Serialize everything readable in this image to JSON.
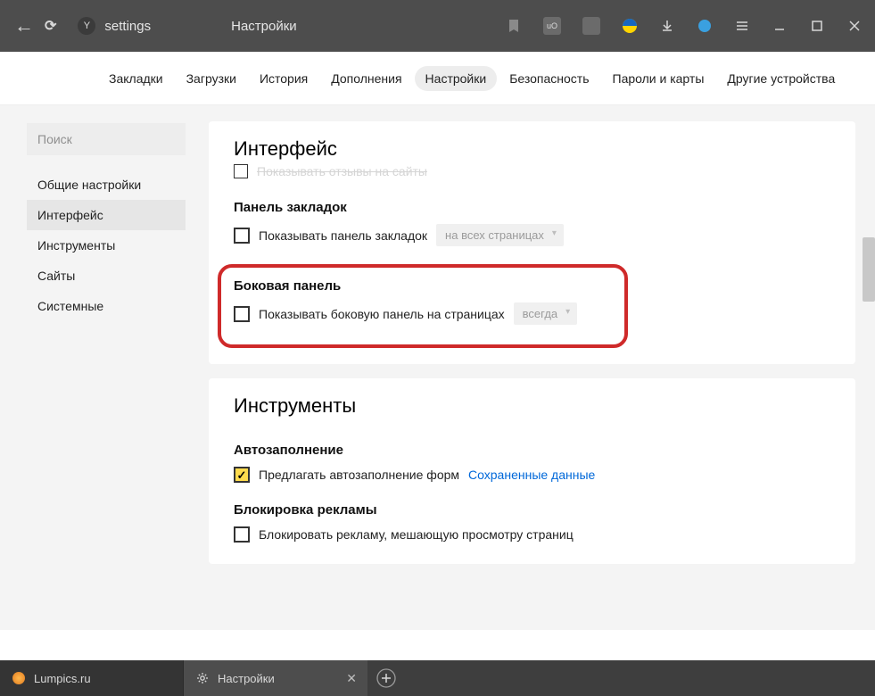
{
  "chrome": {
    "url": "settings",
    "title": "Настройки"
  },
  "topnav": {
    "items": [
      "Закладки",
      "Загрузки",
      "История",
      "Дополнения",
      "Настройки",
      "Безопасность",
      "Пароли и карты",
      "Другие устройства"
    ],
    "active_index": 4
  },
  "sidebar": {
    "search_placeholder": "Поиск",
    "items": [
      "Общие настройки",
      "Интерфейс",
      "Инструменты",
      "Сайты",
      "Системные"
    ],
    "active_index": 1
  },
  "card_interface": {
    "heading": "Интерфейс",
    "cutoff_fragment": "Показывать отзывы на сайты",
    "bookmarks": {
      "title": "Панель закладок",
      "checkbox_label": "Показывать панель закладок",
      "select_value": "на всех страницах"
    },
    "side_panel": {
      "title": "Боковая панель",
      "checkbox_label": "Показывать боковую панель на страницах",
      "select_value": "всегда"
    }
  },
  "card_tools": {
    "heading": "Инструменты",
    "autofill": {
      "title": "Автозаполнение",
      "checkbox_label": "Предлагать автозаполнение форм",
      "link_label": "Сохраненные данные"
    },
    "adblock": {
      "title": "Блокировка рекламы",
      "row1": "Блокировать рекламу, мешающую просмотру страниц"
    }
  },
  "bottom_tabs": {
    "tab1": "Lumpics.ru",
    "tab2": "Настройки"
  }
}
